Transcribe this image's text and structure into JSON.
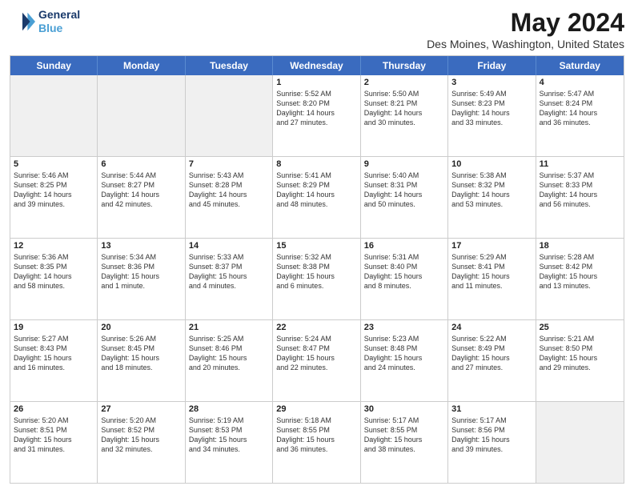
{
  "header": {
    "logo_line1": "General",
    "logo_line2": "Blue",
    "title": "May 2024",
    "location": "Des Moines, Washington, United States"
  },
  "days_of_week": [
    "Sunday",
    "Monday",
    "Tuesday",
    "Wednesday",
    "Thursday",
    "Friday",
    "Saturday"
  ],
  "weeks": [
    [
      {
        "day": "",
        "info": "",
        "shaded": true
      },
      {
        "day": "",
        "info": "",
        "shaded": true
      },
      {
        "day": "",
        "info": "",
        "shaded": true
      },
      {
        "day": "1",
        "info": "Sunrise: 5:52 AM\nSunset: 8:20 PM\nDaylight: 14 hours\nand 27 minutes."
      },
      {
        "day": "2",
        "info": "Sunrise: 5:50 AM\nSunset: 8:21 PM\nDaylight: 14 hours\nand 30 minutes."
      },
      {
        "day": "3",
        "info": "Sunrise: 5:49 AM\nSunset: 8:23 PM\nDaylight: 14 hours\nand 33 minutes."
      },
      {
        "day": "4",
        "info": "Sunrise: 5:47 AM\nSunset: 8:24 PM\nDaylight: 14 hours\nand 36 minutes."
      }
    ],
    [
      {
        "day": "5",
        "info": "Sunrise: 5:46 AM\nSunset: 8:25 PM\nDaylight: 14 hours\nand 39 minutes."
      },
      {
        "day": "6",
        "info": "Sunrise: 5:44 AM\nSunset: 8:27 PM\nDaylight: 14 hours\nand 42 minutes."
      },
      {
        "day": "7",
        "info": "Sunrise: 5:43 AM\nSunset: 8:28 PM\nDaylight: 14 hours\nand 45 minutes."
      },
      {
        "day": "8",
        "info": "Sunrise: 5:41 AM\nSunset: 8:29 PM\nDaylight: 14 hours\nand 48 minutes."
      },
      {
        "day": "9",
        "info": "Sunrise: 5:40 AM\nSunset: 8:31 PM\nDaylight: 14 hours\nand 50 minutes."
      },
      {
        "day": "10",
        "info": "Sunrise: 5:38 AM\nSunset: 8:32 PM\nDaylight: 14 hours\nand 53 minutes."
      },
      {
        "day": "11",
        "info": "Sunrise: 5:37 AM\nSunset: 8:33 PM\nDaylight: 14 hours\nand 56 minutes."
      }
    ],
    [
      {
        "day": "12",
        "info": "Sunrise: 5:36 AM\nSunset: 8:35 PM\nDaylight: 14 hours\nand 58 minutes."
      },
      {
        "day": "13",
        "info": "Sunrise: 5:34 AM\nSunset: 8:36 PM\nDaylight: 15 hours\nand 1 minute."
      },
      {
        "day": "14",
        "info": "Sunrise: 5:33 AM\nSunset: 8:37 PM\nDaylight: 15 hours\nand 4 minutes."
      },
      {
        "day": "15",
        "info": "Sunrise: 5:32 AM\nSunset: 8:38 PM\nDaylight: 15 hours\nand 6 minutes."
      },
      {
        "day": "16",
        "info": "Sunrise: 5:31 AM\nSunset: 8:40 PM\nDaylight: 15 hours\nand 8 minutes."
      },
      {
        "day": "17",
        "info": "Sunrise: 5:29 AM\nSunset: 8:41 PM\nDaylight: 15 hours\nand 11 minutes."
      },
      {
        "day": "18",
        "info": "Sunrise: 5:28 AM\nSunset: 8:42 PM\nDaylight: 15 hours\nand 13 minutes."
      }
    ],
    [
      {
        "day": "19",
        "info": "Sunrise: 5:27 AM\nSunset: 8:43 PM\nDaylight: 15 hours\nand 16 minutes."
      },
      {
        "day": "20",
        "info": "Sunrise: 5:26 AM\nSunset: 8:45 PM\nDaylight: 15 hours\nand 18 minutes."
      },
      {
        "day": "21",
        "info": "Sunrise: 5:25 AM\nSunset: 8:46 PM\nDaylight: 15 hours\nand 20 minutes."
      },
      {
        "day": "22",
        "info": "Sunrise: 5:24 AM\nSunset: 8:47 PM\nDaylight: 15 hours\nand 22 minutes."
      },
      {
        "day": "23",
        "info": "Sunrise: 5:23 AM\nSunset: 8:48 PM\nDaylight: 15 hours\nand 24 minutes."
      },
      {
        "day": "24",
        "info": "Sunrise: 5:22 AM\nSunset: 8:49 PM\nDaylight: 15 hours\nand 27 minutes."
      },
      {
        "day": "25",
        "info": "Sunrise: 5:21 AM\nSunset: 8:50 PM\nDaylight: 15 hours\nand 29 minutes."
      }
    ],
    [
      {
        "day": "26",
        "info": "Sunrise: 5:20 AM\nSunset: 8:51 PM\nDaylight: 15 hours\nand 31 minutes."
      },
      {
        "day": "27",
        "info": "Sunrise: 5:20 AM\nSunset: 8:52 PM\nDaylight: 15 hours\nand 32 minutes."
      },
      {
        "day": "28",
        "info": "Sunrise: 5:19 AM\nSunset: 8:53 PM\nDaylight: 15 hours\nand 34 minutes."
      },
      {
        "day": "29",
        "info": "Sunrise: 5:18 AM\nSunset: 8:55 PM\nDaylight: 15 hours\nand 36 minutes."
      },
      {
        "day": "30",
        "info": "Sunrise: 5:17 AM\nSunset: 8:55 PM\nDaylight: 15 hours\nand 38 minutes."
      },
      {
        "day": "31",
        "info": "Sunrise: 5:17 AM\nSunset: 8:56 PM\nDaylight: 15 hours\nand 39 minutes."
      },
      {
        "day": "",
        "info": "",
        "shaded": true
      }
    ]
  ]
}
